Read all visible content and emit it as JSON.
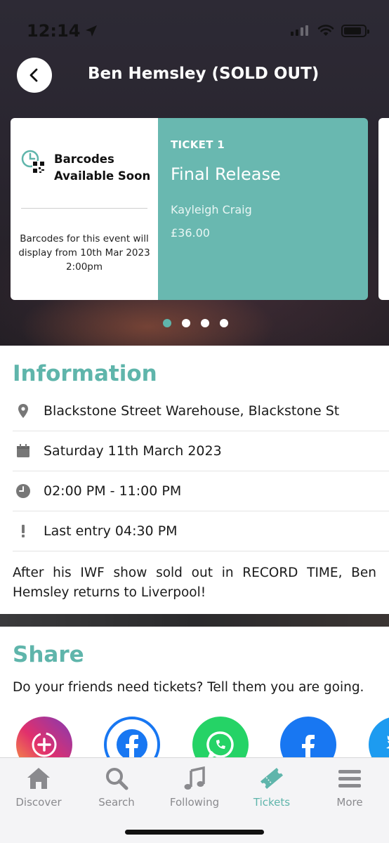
{
  "status_bar": {
    "time": "12:14"
  },
  "header": {
    "title": "Ben Hemsley (SOLD OUT)"
  },
  "ticket": {
    "barcode_title": "Barcodes Available Soon",
    "barcode_message": "Barcodes for this event will display from 10th Mar 2023 2:00pm",
    "label": "TICKET 1",
    "name": "Final Release",
    "holder": "Kayleigh Craig",
    "price": "£36.00"
  },
  "carousel": {
    "count": 4,
    "active_index": 0
  },
  "information": {
    "heading": "Information",
    "venue": "Blackstone Street Warehouse, Blackstone St",
    "date": "Saturday 11th March 2023",
    "time": "02:00 PM - 11:00 PM",
    "last_entry": "Last entry 04:30 PM",
    "description": "After his IWF show sold out in RECORD TIME, Ben Hemsley returns to Liverpool!"
  },
  "share": {
    "heading": "Share",
    "text": "Do your friends need tickets? Tell them you are going.",
    "buttons": [
      "instagram-story-icon",
      "facebook-messenger-icon",
      "whatsapp-icon",
      "facebook-icon",
      "twitter-icon"
    ]
  },
  "tabs": [
    {
      "label": "Discover",
      "icon": "home-icon"
    },
    {
      "label": "Search",
      "icon": "search-icon"
    },
    {
      "label": "Following",
      "icon": "music-note-icon"
    },
    {
      "label": "Tickets",
      "icon": "ticket-icon",
      "active": true
    },
    {
      "label": "More",
      "icon": "menu-icon"
    }
  ],
  "colors": {
    "accent": "#5fb5ab",
    "ticket_panel": "#69b8b0",
    "facebook": "#1877f2",
    "whatsapp": "#25d366"
  }
}
